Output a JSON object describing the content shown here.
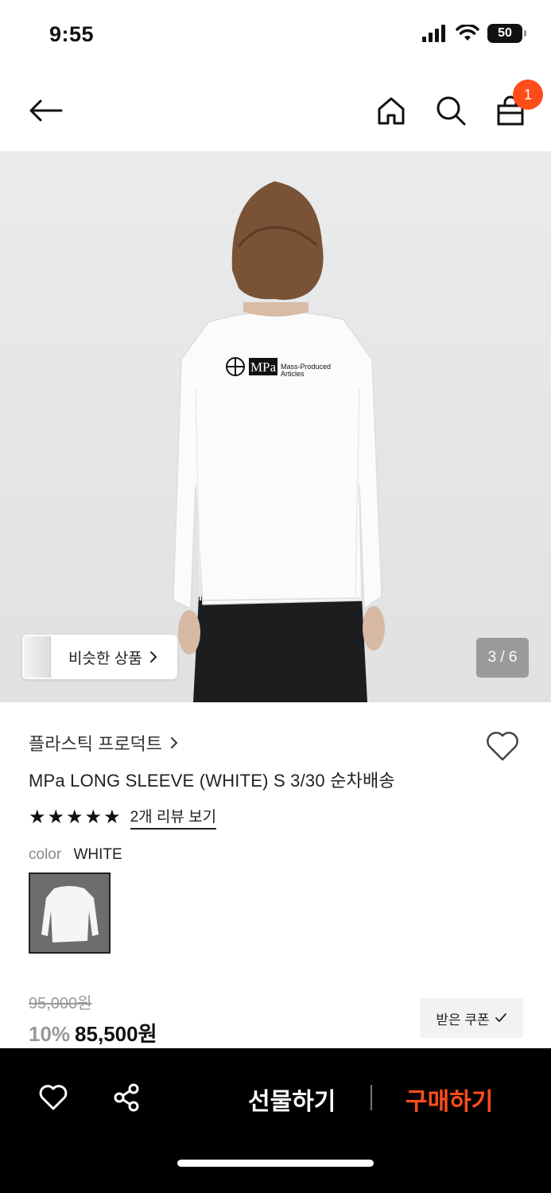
{
  "status": {
    "time": "9:55",
    "battery": "50"
  },
  "header": {
    "cart_count": "1"
  },
  "gallery": {
    "similar_label": "비슷한 상품",
    "counter": "3 / 6",
    "logo_line1": "Mass-Produced",
    "logo_line2": "Articles",
    "logo_mark": "MPa"
  },
  "product": {
    "brand": "플라스틱 프로덕트",
    "title": "MPa LONG SLEEVE (WHITE) S 3/30 순차배송",
    "rating": 5,
    "review_link": "2개 리뷰 보기",
    "color_label": "color",
    "color_value": "WHITE"
  },
  "pricing": {
    "original": "95,000원",
    "discount": "10%",
    "price": "85,500원",
    "coupon_label": "받은 쿠폰"
  },
  "bottom_bar": {
    "gift_label": "선물하기",
    "buy_label": "구매하기"
  },
  "colors": {
    "accent": "#ff4d1a",
    "bottom_bar": "#000000"
  },
  "icons": [
    "back-arrow-icon",
    "home-icon",
    "search-icon",
    "bag-icon",
    "heart-icon",
    "share-icon",
    "chevron-right-icon",
    "check-icon",
    "star-icon"
  ]
}
